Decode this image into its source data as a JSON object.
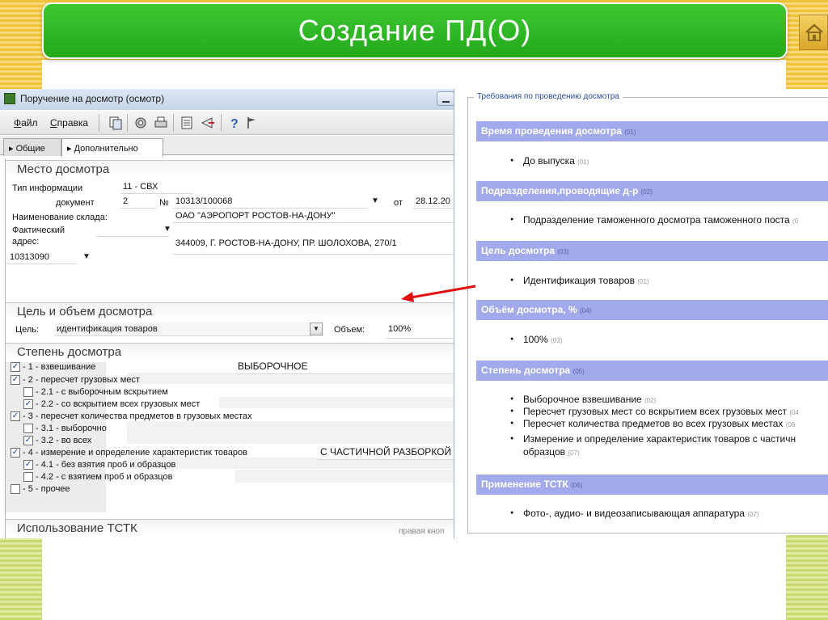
{
  "slide": {
    "title": "Создание ПД(О)",
    "home_icon": "home-icon"
  },
  "window": {
    "title": "Поручение на досмотр (осмотр)",
    "menu": [
      "Файл",
      "Справка"
    ],
    "toolbar_icons": [
      "copy-icon",
      "settings-icon",
      "print-icon",
      "list-icon",
      "send-icon",
      "help-icon",
      "flag-icon"
    ],
    "tabs": [
      "Общие",
      "Дополнительно"
    ],
    "active_tab": "Дополнительно"
  },
  "place": {
    "section": "Место досмотра",
    "info_type_label": "Тип информации",
    "info_type_value": "11 - СВХ",
    "doc_label": "документ",
    "doc_num": "2",
    "num_sign": "№",
    "doc_number": "10313/100068",
    "date_from_label": "от",
    "date_value": "28.12.20",
    "warehouse_label": "Наименование склада:",
    "warehouse_value": "ОАО \"АЭРОПОРТ РОСТОВ-НА-ДОНУ\"",
    "actual_label": "Фактический",
    "address_label": "адрес:",
    "address_value": "344009, Г. РОСТОВ-НА-ДОНУ, ПР. ШОЛОХОВА, 270/1",
    "code_value": "10313090"
  },
  "purpose": {
    "section": "Цель и объем досмотра",
    "goal_label": "Цель:",
    "goal_value": "идентификация товаров",
    "volume_label": "Объем:",
    "volume_value": "100%"
  },
  "degree": {
    "section": "Степень досмотра",
    "items": [
      {
        "text": "- 1 - взвешивание",
        "checked": true,
        "value": "ВЫБОРОЧНОЕ"
      },
      {
        "text": "- 2 - пересчет грузовых мест",
        "checked": true,
        "value": ""
      },
      {
        "text": "- 2.1 - с выборочным вскрытием",
        "checked": false,
        "value": ""
      },
      {
        "text": "- 2.2 - со вскрытием всех грузовых мест",
        "checked": true,
        "value": ""
      },
      {
        "text": "- 3 - пересчет количества предметов в грузовых  местах",
        "checked": true,
        "value": ""
      },
      {
        "text": "- 3.1 - выборочно",
        "checked": false,
        "value": ""
      },
      {
        "text": "- 3.2 - во всех",
        "checked": true,
        "value": ""
      },
      {
        "text": "- 4 - измерение и определение характеристик товаров",
        "checked": true,
        "value": "С ЧАСТИЧНОЙ РАЗБОРКОЙ"
      },
      {
        "text": "- 4.1 - без взятия проб и образцов",
        "checked": true,
        "value": ""
      },
      {
        "text": "- 4.2 - с взятием проб и образцов",
        "checked": false,
        "value": ""
      },
      {
        "text": "- 5 - прочее",
        "checked": false,
        "value": ""
      }
    ]
  },
  "tstk": {
    "section": "Использование ТСТК",
    "hint": "правая кноп"
  },
  "requirements": {
    "legend": "Требования по проведению досмотра",
    "blocks": [
      {
        "head": "Время проведения досмотра",
        "code": "(01)",
        "items": [
          {
            "text": "До выпуска",
            "code": "(01)"
          }
        ]
      },
      {
        "head": "Подразделения,проводящие д-р",
        "code": "(02)",
        "items": [
          {
            "text": "Подразделение таможенного досмотра таможенного поста",
            "code": "(0"
          }
        ]
      },
      {
        "head": "Цель досмотра",
        "code": "(03)",
        "items": [
          {
            "text": "Идентификация товаров",
            "code": "(01)"
          }
        ]
      },
      {
        "head": "Объём досмотра, %",
        "code": "(04)",
        "items": [
          {
            "text": "100%",
            "code": "(03)"
          }
        ]
      },
      {
        "head": "Степень досмотра",
        "code": "(05)",
        "items": [
          {
            "text": "Выборочное взвешивание",
            "code": "(02)"
          },
          {
            "text": "Пересчет грузовых мест со вскрытием всех грузовых мест",
            "code": "(04"
          },
          {
            "text": "Пересчет количества предметов во всех грузовых местах",
            "code": "(06"
          },
          {
            "text": "Измерение и определение характеристик товаров с частичн",
            "code": ""
          },
          {
            "text": "образцов",
            "code": "(07)"
          }
        ]
      },
      {
        "head": "Применение ТСТК",
        "code": "(06)",
        "items": [
          {
            "text": "Фото-, аудио- и видеозаписывающая аппаратура",
            "code": "(07)"
          }
        ]
      }
    ]
  },
  "colors": {
    "title_green": "#2fb626",
    "header_blue": "#a2aaeb",
    "arrow_red": "#e01010"
  }
}
